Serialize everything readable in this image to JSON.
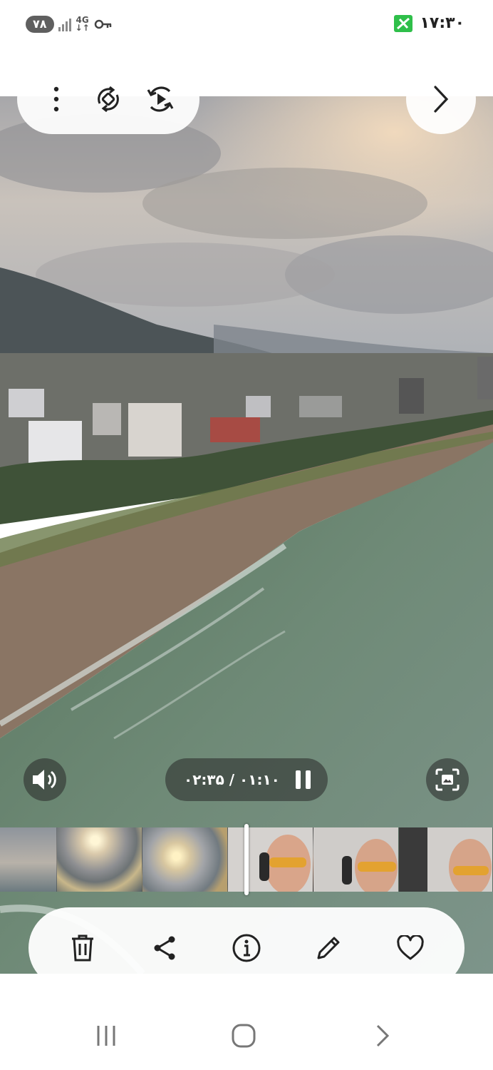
{
  "status_bar": {
    "notification_badge": "۷۸",
    "network_type": "4G",
    "time": "۱۷:۳۰",
    "battery_color": "#2fbf4a"
  },
  "toolbar": {
    "icons": [
      "more-options-icon",
      "rotate-icon",
      "motion-photo-icon",
      "next-icon"
    ]
  },
  "player": {
    "time_display": "۰۲:۳۵ / ۰۱:۱۰",
    "state": "playing",
    "icons": [
      "volume-icon",
      "pause-icon",
      "capture-frame-icon"
    ]
  },
  "timeline": {
    "playhead_progress": 0.5,
    "frames": [
      "cloudy-sky",
      "sunset-over-sea",
      "sunset-clouds",
      "paraglider-selfie",
      "paraglider-selfie",
      "paraglider-selfie",
      "paraglider-selfie"
    ]
  },
  "actions": {
    "icons": [
      "delete-icon",
      "share-icon",
      "info-icon",
      "edit-icon",
      "favorite-icon"
    ]
  },
  "nav_bar": {
    "icons": [
      "recent-apps-icon",
      "home-icon",
      "back-icon"
    ]
  },
  "colors": {
    "overlay_light": "#ffffff",
    "overlay_dark": "#2a2a2a",
    "icon": "#222222"
  }
}
